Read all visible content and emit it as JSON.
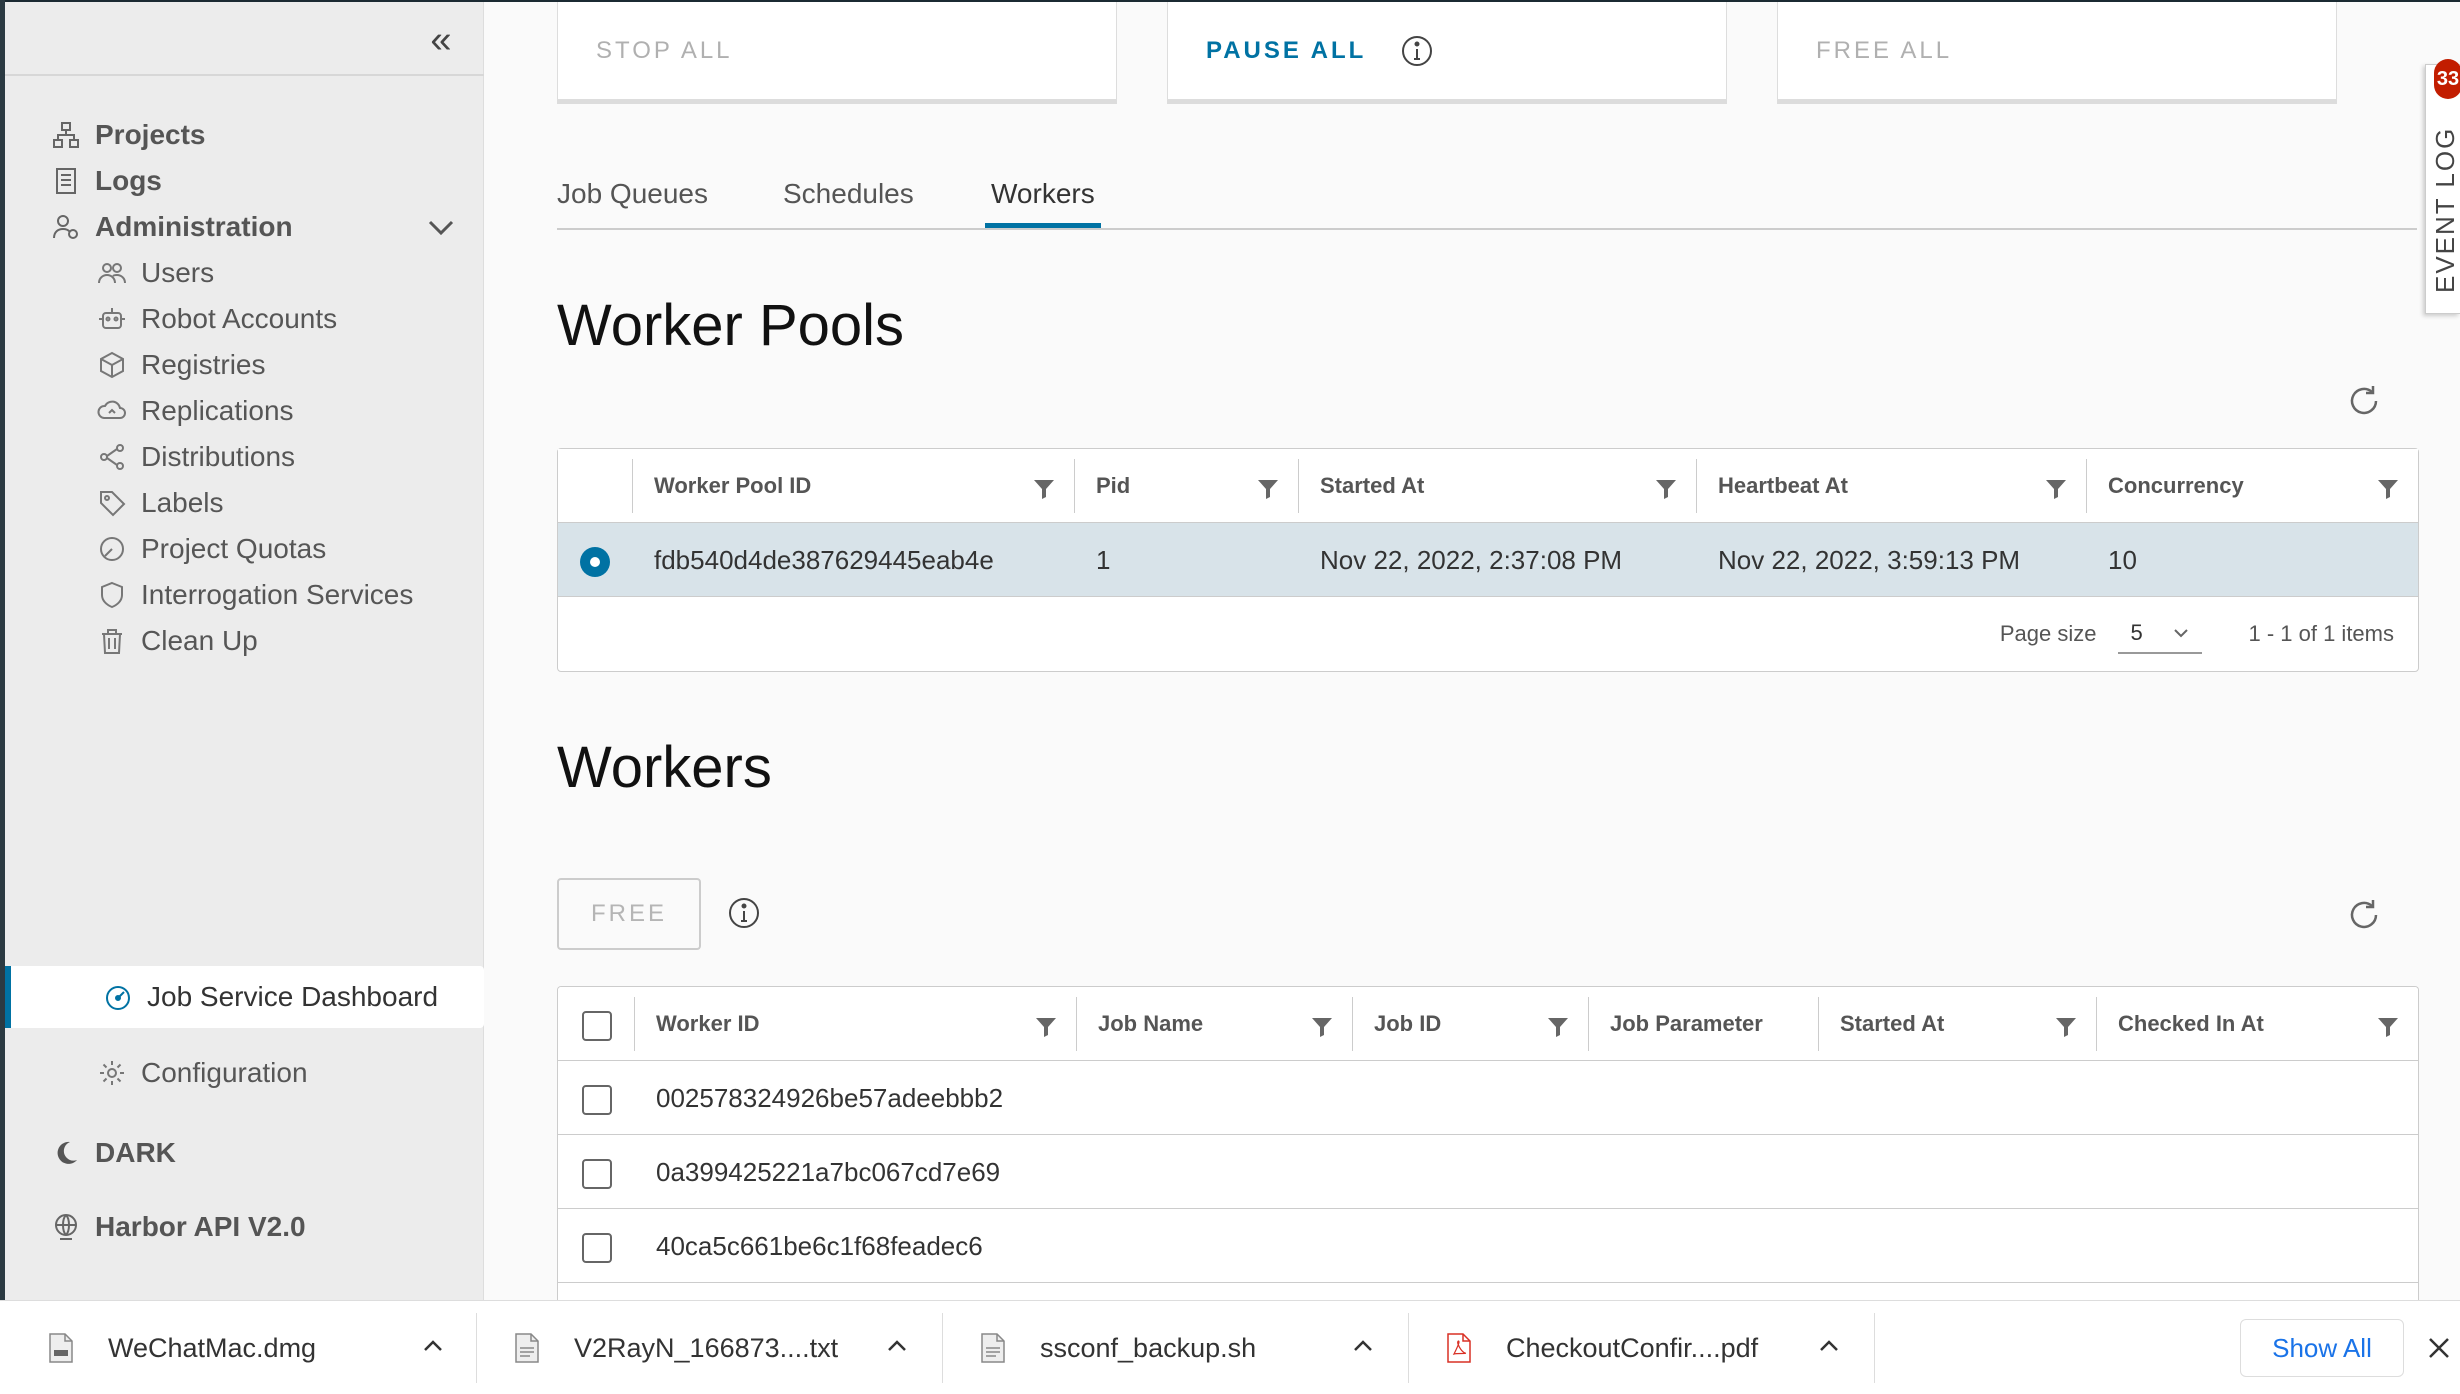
{
  "sidebar": {
    "items": [
      {
        "label": "Projects",
        "icon": "projects-icon"
      },
      {
        "label": "Logs",
        "icon": "logs-icon"
      },
      {
        "label": "Administration",
        "icon": "administration-icon"
      },
      {
        "label": "Users",
        "icon": "users-icon"
      },
      {
        "label": "Robot Accounts",
        "icon": "robot-icon"
      },
      {
        "label": "Registries",
        "icon": "registries-icon"
      },
      {
        "label": "Replications",
        "icon": "replications-icon"
      },
      {
        "label": "Distributions",
        "icon": "distributions-icon"
      },
      {
        "label": "Labels",
        "icon": "labels-icon"
      },
      {
        "label": "Project Quotas",
        "icon": "quotas-icon"
      },
      {
        "label": "Interrogation Services",
        "icon": "shield-icon"
      },
      {
        "label": "Clean Up",
        "icon": "trash-icon"
      },
      {
        "label": "Job Service Dashboard",
        "icon": "dashboard-icon"
      },
      {
        "label": "Configuration",
        "icon": "gear-icon"
      },
      {
        "label": "DARK",
        "icon": "moon-icon"
      },
      {
        "label": "Harbor API V2.0",
        "icon": "api-icon"
      }
    ],
    "active": "Job Service Dashboard"
  },
  "actions": {
    "stop_all": "STOP ALL",
    "pause_all": "PAUSE ALL",
    "free_all": "FREE ALL"
  },
  "tabs": [
    {
      "label": "Job Queues"
    },
    {
      "label": "Schedules"
    },
    {
      "label": "Workers"
    }
  ],
  "active_tab": "Workers",
  "worker_pools": {
    "title": "Worker Pools",
    "columns": [
      "Worker Pool ID",
      "Pid",
      "Started At",
      "Heartbeat At",
      "Concurrency"
    ],
    "rows": [
      {
        "id": "fdb540d4de387629445eab4e",
        "pid": "1",
        "started_at": "Nov 22, 2022, 2:37:08 PM",
        "heartbeat_at": "Nov 22, 2022, 3:59:13 PM",
        "concurrency": "10"
      }
    ],
    "page_size_label": "Page size",
    "page_size": "5",
    "pagination": "1 - 1 of 1 items"
  },
  "workers": {
    "title": "Workers",
    "free_label": "FREE",
    "columns": [
      "Worker ID",
      "Job Name",
      "Job ID",
      "Job Parameter",
      "Started At",
      "Checked In At"
    ],
    "rows": [
      {
        "id": "002578324926be57adeebbb2"
      },
      {
        "id": "0a399425221a7bc067cd7e69"
      },
      {
        "id": "40ca5c661be6c1f68feadec6"
      }
    ]
  },
  "event_log": {
    "label": "EVENT LOG",
    "count": "33"
  },
  "downloads": {
    "items": [
      {
        "name": "WeChatMac.dmg"
      },
      {
        "name": "V2RayN_166873....txt"
      },
      {
        "name": "ssconf_backup.sh"
      },
      {
        "name": "CheckoutConfir....pdf"
      }
    ],
    "show_all": "Show All"
  },
  "colors": {
    "accent": "#0072a3",
    "badge": "#c21d00",
    "selected_row": "#d8e3e9",
    "link": "#1a73e8"
  }
}
